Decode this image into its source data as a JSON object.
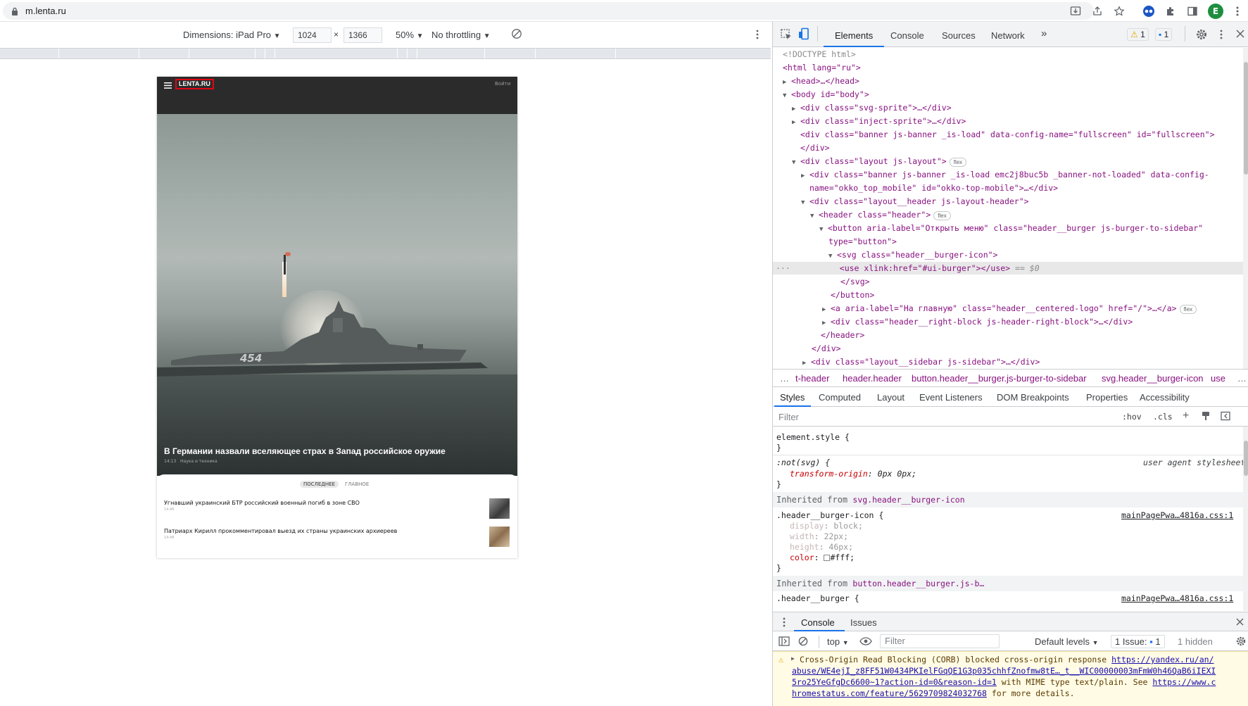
{
  "browser": {
    "url": "m.lenta.ru",
    "profile_initial": "E"
  },
  "emulation": {
    "dimensions": "Dimensions: iPad Pro",
    "width": "1024",
    "x_sep": "×",
    "height": "1366",
    "zoom": "50%",
    "throttling": "No throttling"
  },
  "site": {
    "logo": "LENTA.RU",
    "login": "Войти",
    "headline": "В Германии назвали вселяющее страх в Запад российское оружие",
    "headline_time": "14:13",
    "headline_rubric": "Наука и техника",
    "ship_number": "454",
    "tabs": [
      "ПОСЛЕДНЕЕ",
      "ГЛАВНОЕ"
    ],
    "news": [
      {
        "title": "Угнавший украинский БТР российский военный погиб в зоне СВО",
        "time": "14:46"
      },
      {
        "title": "Патриарх Кирилл прокомментировал выезд их страны украинских архиереев",
        "time": "14:48"
      }
    ]
  },
  "devtools": {
    "tabs": [
      "Elements",
      "Console",
      "Sources",
      "Network"
    ],
    "more_tabs": "»",
    "warnings_count": "1",
    "messages_count": "1",
    "dom_lines": [
      {
        "cls": "cm",
        "text": "<!DOCTYPE html>"
      },
      {
        "text": "<html lang=\"ru\">"
      },
      {
        "text": "<head>…</head>"
      },
      {
        "text": "<body id=\"body\">"
      },
      {
        "text": "<div class=\"svg-sprite\">…</div>"
      },
      {
        "text": "<div class=\"inject-sprite\">…</div>"
      },
      {
        "text": "<div class=\"banner js-banner _is-load\" data-config-name=\"fullscreen\" id=\"fullscreen\">"
      },
      {
        "text": "</div>"
      },
      {
        "text": "<div class=\"layout js-layout\">",
        "pill": "flex"
      },
      {
        "text": "<div class=\"banner js-banner _is-load emc2j8buc5b _banner-not-loaded\" data-config-"
      },
      {
        "text": "name=\"okko_top_mobile\" id=\"okko-top-mobile\">…</div>"
      },
      {
        "text": "<div class=\"layout__header js-layout-header\">"
      },
      {
        "text": "<header class=\"header\">",
        "pill": "flex"
      },
      {
        "text": "<button aria-label=\"Открыть меню\" class=\"header__burger js-burger-to-sidebar\""
      },
      {
        "text": "type=\"button\">"
      },
      {
        "text": "<svg class=\"header__burger-icon\">"
      },
      {
        "text": "<use xlink:href=\"#ui-burger\"></use>",
        "suffix": " == $0"
      },
      {
        "text": "</svg>"
      },
      {
        "text": "</button>"
      },
      {
        "text": "<a aria-label=\"На главную\" class=\"header__centered-logo\" href=\"/\">…</a>",
        "pill": "flex"
      },
      {
        "text": "<div class=\"header__right-block js-header-right-block\">…</div>"
      },
      {
        "text": "</header>"
      },
      {
        "text": "</div>"
      },
      {
        "text": "<div class=\"layout__sidebar js-sidebar\">…</div>"
      }
    ],
    "breadcrumbs": [
      "…",
      "t-header",
      "header.header",
      "button.header__burger.js-burger-to-sidebar",
      "svg.header__burger-icon",
      "use",
      "…"
    ],
    "style_tabs": [
      "Styles",
      "Computed",
      "Layout",
      "Event Listeners",
      "DOM Breakpoints",
      "Properties",
      "Accessibility"
    ],
    "filter_placeholder": "Filter",
    "hov": ":hov",
    "cls": ".cls",
    "styles": {
      "element_style": "element.style {",
      "close": "}",
      "not_svg_selector": ":not(svg) {",
      "ua_label": "user agent stylesheet",
      "transform_prop": "transform-origin",
      "transform_val": "0px 0px;",
      "inherited_label": "Inherited from",
      "inherited_from_1": "svg.header__burger-icon",
      "burger_icon_selector": ".header__burger-icon {",
      "source_link": "mainPagePwa…4816a.css:1",
      "display_prop": "display",
      "display_val": "block;",
      "width_prop": "width",
      "width_val": "22px;",
      "height_prop": "height",
      "height_val": "46px;",
      "color_prop": "color",
      "color_val": "#fff;",
      "inherited_from_2": "button.header__burger.js-b…",
      "burger_selector": ".header__burger {",
      "source_link_2": "mainPagePwa…4816a.css:1"
    },
    "drawer": {
      "tabs": [
        "Console",
        "Issues"
      ],
      "context": "top",
      "filter_placeholder": "Filter",
      "levels": "Default levels",
      "issues": "1 Issue:",
      "issues_count": "1",
      "hidden": "1 hidden",
      "warning_line1_a": "Cross-Origin Read Blocking (CORB) blocked cross-origin response ",
      "warning_link": "https://yandex.ru/an/",
      "warning_line2": "abuse/WE4ejI_z8FF51W0434PKIelFGqQE1G3p035chhfZnofmw8tE…_t__WIC00000003mFmW0h46QaB6iIEXI",
      "warning_line3": "5ro25YeGfgDc6600~1?action-id=0&reason-id=1",
      "warning_line3_b": " with MIME type text/plain. See ",
      "warning_link2": "https://www.c",
      "warning_line4": "hromestatus.com/feature/5629709824032768",
      "warning_line4_b": " for more details."
    }
  },
  "colors": {
    "accent_blue": "#1a73e8",
    "lenta_red": "#e30613",
    "warning_bg": "#fffbe5"
  }
}
